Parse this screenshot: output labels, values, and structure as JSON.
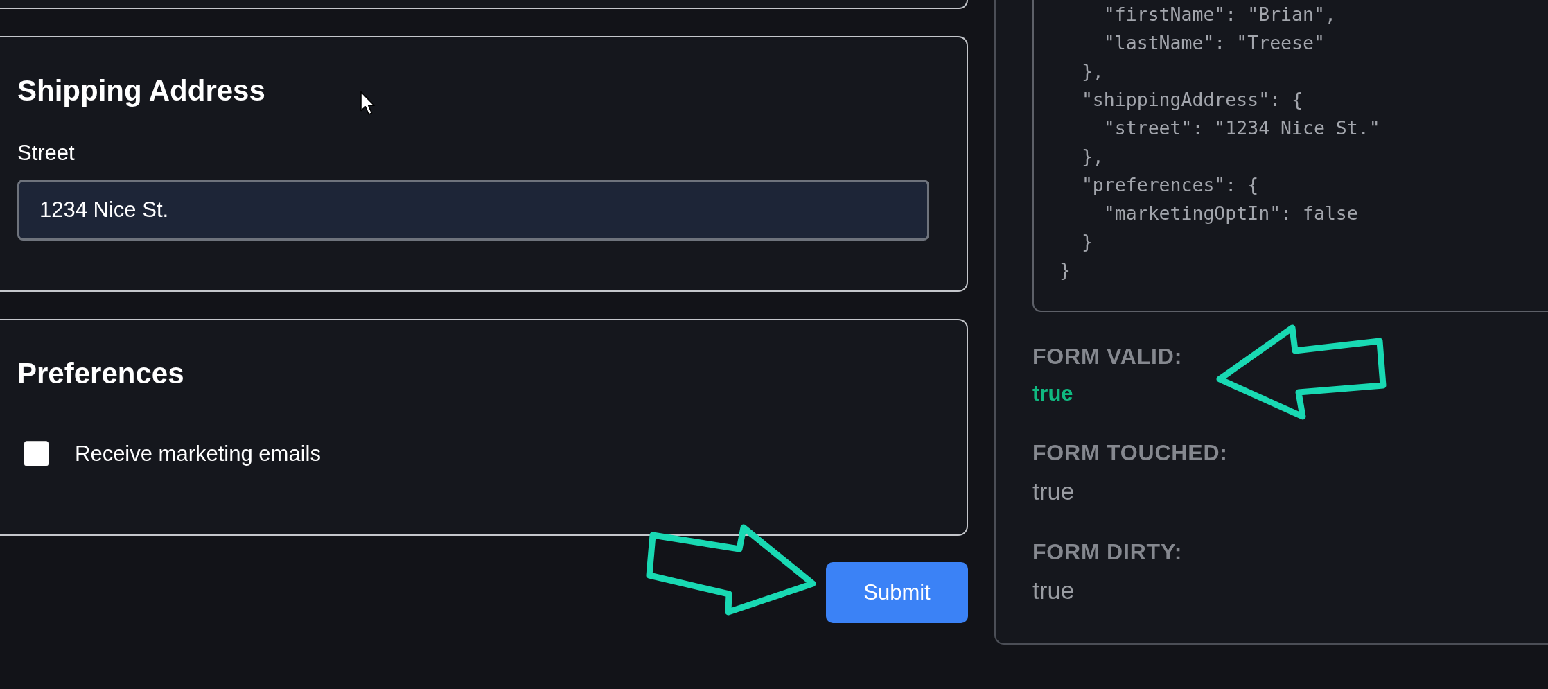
{
  "form": {
    "sections": [
      {
        "title": "Shipping Address",
        "fields": [
          {
            "kind": "text",
            "label": "Street",
            "value": "1234 Nice St."
          }
        ]
      },
      {
        "title": "Preferences",
        "fields": [
          {
            "kind": "checkbox",
            "label": "Receive marketing emails",
            "checked": false
          }
        ]
      }
    ],
    "submit": {
      "label": "Submit",
      "annotated": true
    }
  },
  "state_panel": {
    "code_lines": [
      "    \"firstName\": \"Brian\",",
      "    \"lastName\": \"Treese\"",
      "  },",
      "  \"shippingAddress\": {",
      "    \"street\": \"1234 Nice St.\"",
      "  },",
      "  \"preferences\": {",
      "    \"marketingOptIn\": false",
      "  }",
      "}"
    ],
    "stats": [
      {
        "label": "FORM VALID:",
        "value": "true",
        "highlighted": true,
        "annotated": true
      },
      {
        "label": "FORM TOUCHED:",
        "value": "true",
        "highlighted": false,
        "annotated": false
      },
      {
        "label": "FORM DIRTY:",
        "value": "true",
        "highlighted": false,
        "annotated": false
      }
    ]
  }
}
